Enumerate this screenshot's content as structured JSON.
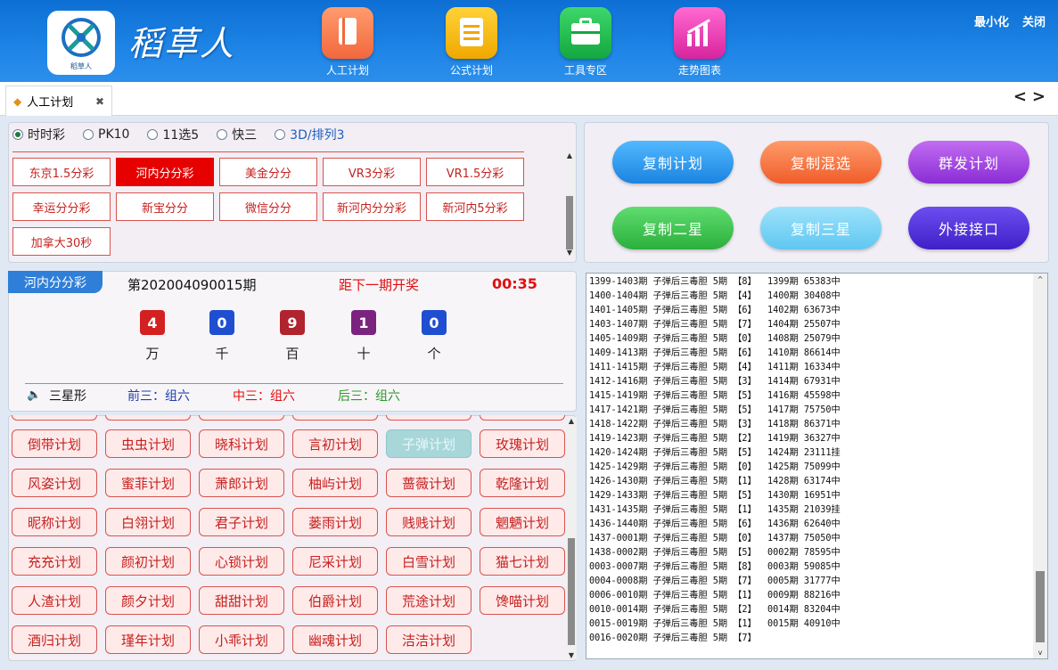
{
  "app": {
    "title": "稻草人",
    "logo_text": "稻草人",
    "minimize": "最小化",
    "close": "关闭"
  },
  "nav": [
    {
      "label": "人工计划",
      "icon": "notebook-icon"
    },
    {
      "label": "公式计划",
      "icon": "notepad-icon"
    },
    {
      "label": "工具专区",
      "icon": "toolbox-icon"
    },
    {
      "label": "走势图表",
      "icon": "trend-chart-icon"
    }
  ],
  "tab": {
    "label": "人工计划",
    "close": "✖"
  },
  "tab_nav": {
    "prev": "<",
    "next": ">"
  },
  "lottery_types": [
    {
      "label": "时时彩",
      "selected": true
    },
    {
      "label": "PK10",
      "selected": false
    },
    {
      "label": "11选5",
      "selected": false
    },
    {
      "label": "快三",
      "selected": false
    },
    {
      "label": "3D/排列3",
      "selected": false
    }
  ],
  "categories": [
    "东京1.5分彩",
    "河内分分彩",
    "美金分分",
    "VR3分彩",
    "VR1.5分彩",
    "幸运分分彩",
    "新宝分分",
    "微信分分",
    "新河内分分彩",
    "新河内5分彩",
    "加拿大30秒"
  ],
  "selected_category": "河内分分彩",
  "actions": [
    "复制计划",
    "复制混选",
    "群发计划",
    "复制二星",
    "复制三星",
    "外接接口"
  ],
  "result": {
    "lottery": "河内分分彩",
    "period": "第202004090015期",
    "countdown_label": "距下一期开奖",
    "countdown": "00:35",
    "balls": [
      {
        "value": "4",
        "pos": "万",
        "color": "#d32020"
      },
      {
        "value": "0",
        "pos": "千",
        "color": "#1f4fd0"
      },
      {
        "value": "9",
        "pos": "百",
        "color": "#b0242e"
      },
      {
        "value": "1",
        "pos": "十",
        "color": "#7a2480"
      },
      {
        "value": "0",
        "pos": "个",
        "color": "#1f4fd0"
      }
    ],
    "shape_label": "三星形",
    "front": "前三：组六",
    "middle": "中三：组六",
    "back": "后三：组六"
  },
  "plans": [
    [
      "倒带计划",
      "虫虫计划",
      "晓科计划",
      "言初计划",
      "子弹计划",
      "玫瑰计划"
    ],
    [
      "风姿计划",
      "蜜菲计划",
      "萧郎计划",
      "柚屿计划",
      "蔷薇计划",
      "乾隆计划"
    ],
    [
      "昵称计划",
      "白翎计划",
      "君子计划",
      "蒌雨计划",
      "贱贱计划",
      "魍魉计划"
    ],
    [
      "充充计划",
      "颜初计划",
      "心锁计划",
      "尼采计划",
      "白雪计划",
      "猫七计划"
    ],
    [
      "人渣计划",
      "颜夕计划",
      "甜甜计划",
      "伯爵计划",
      "荒途计划",
      "馋喵计划"
    ],
    [
      "酒归计划",
      "瑾年计划",
      "小乖计划",
      "幽魂计划",
      "洁洁计划"
    ]
  ],
  "selected_plan": "子弹计划",
  "log": [
    "1399-1403期 子弹后三毒胆 5期 【8】  1399期 65383中",
    "1400-1404期 子弹后三毒胆 5期 【4】  1400期 30408中",
    "1401-1405期 子弹后三毒胆 5期 【6】  1402期 63673中",
    "1403-1407期 子弹后三毒胆 5期 【7】  1404期 25507中",
    "1405-1409期 子弹后三毒胆 5期 【0】  1408期 25079中",
    "1409-1413期 子弹后三毒胆 5期 【6】  1410期 86614中",
    "1411-1415期 子弹后三毒胆 5期 【4】  1411期 16334中",
    "1412-1416期 子弹后三毒胆 5期 【3】  1414期 67931中",
    "1415-1419期 子弹后三毒胆 5期 【5】  1416期 45598中",
    "1417-1421期 子弹后三毒胆 5期 【5】  1417期 75750中",
    "1418-1422期 子弹后三毒胆 5期 【3】  1418期 86371中",
    "1419-1423期 子弹后三毒胆 5期 【2】  1419期 36327中",
    "1420-1424期 子弹后三毒胆 5期 【5】  1424期 23111挂",
    "1425-1429期 子弹后三毒胆 5期 【0】  1425期 75099中",
    "1426-1430期 子弹后三毒胆 5期 【1】  1428期 63174中",
    "1429-1433期 子弹后三毒胆 5期 【5】  1430期 16951中",
    "1431-1435期 子弹后三毒胆 5期 【1】  1435期 21039挂",
    "1436-1440期 子弹后三毒胆 5期 【6】  1436期 62640中",
    "1437-0001期 子弹后三毒胆 5期 【0】  1437期 75050中",
    "1438-0002期 子弹后三毒胆 5期 【5】  0002期 78595中",
    "0003-0007期 子弹后三毒胆 5期 【8】  0003期 59085中",
    "0004-0008期 子弹后三毒胆 5期 【7】  0005期 31777中",
    "0006-0010期 子弹后三毒胆 5期 【1】  0009期 88216中",
    "0010-0014期 子弹后三毒胆 5期 【2】  0014期 83204中",
    "0015-0019期 子弹后三毒胆 5期 【1】  0015期 40910中",
    "0016-0020期 子弹后三毒胆 5期 【7】"
  ]
}
